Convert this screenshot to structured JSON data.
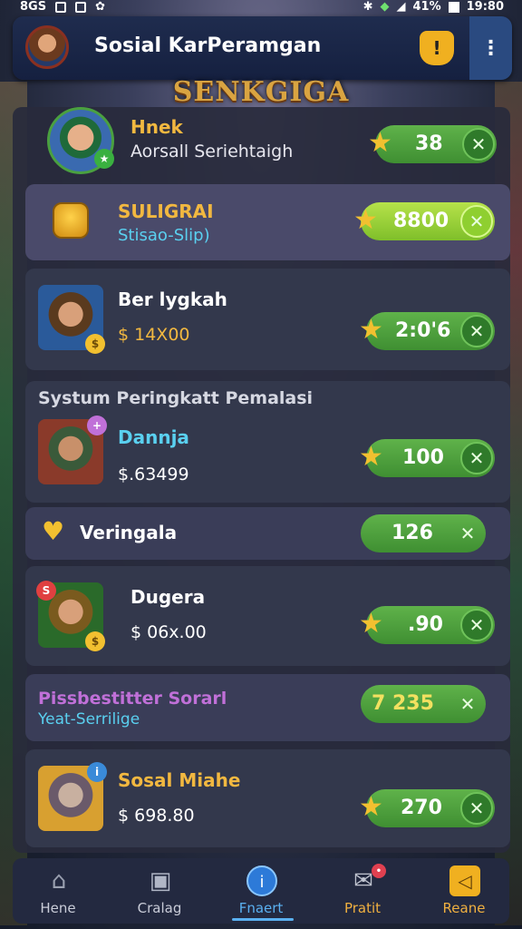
{
  "status_bar": {
    "left_text": "8GS",
    "battery": "41%",
    "time": "19:80"
  },
  "header": {
    "title": "Sosial KarPeramgan",
    "shield_label": "!",
    "menu_label": "⋮"
  },
  "banner": "SENKGIGA",
  "rows": [
    {
      "name": "Hnek",
      "sub": "Aorsall Seriehtaigh",
      "value": "38"
    },
    {
      "name": "SULIGRAI",
      "sub": "Stisao-Slip)",
      "value": "8800"
    },
    {
      "name": "Ber lygkah",
      "sub": "$ 14X00",
      "value": "2:0'6"
    },
    {
      "section_title": "Systum Peringkatt Pemalasi",
      "name": "Dannja",
      "sub": "$.63499",
      "value": "100"
    },
    {
      "name": "Veringala",
      "value": "126"
    },
    {
      "name": "Dugera",
      "sub": "$ 06x.00",
      "value": ".90"
    },
    {
      "name": "Pissbestitter Sorarl",
      "sub": "Yeat-Serrilige",
      "value": "7 235"
    },
    {
      "name": "Sosal Miahe",
      "sub": "$ 698.80",
      "value": "270"
    }
  ],
  "nav": [
    {
      "label": "Hene",
      "icon": "home-icon"
    },
    {
      "label": "Cralag",
      "icon": "box-icon"
    },
    {
      "label": "Fnaert",
      "icon": "info-icon"
    },
    {
      "label": "Pratit",
      "icon": "chat-icon"
    },
    {
      "label": "Reane",
      "icon": "back-icon"
    }
  ],
  "colors": {
    "accent_green": "#4ea63d",
    "gold": "#f2c030",
    "cyan": "#5ad0f0",
    "purple": "#c070d8"
  }
}
